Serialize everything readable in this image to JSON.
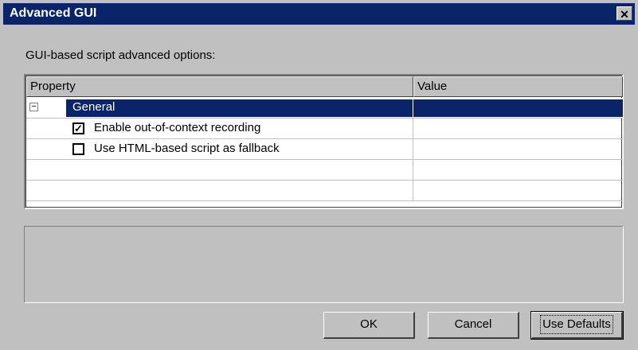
{
  "window": {
    "title": "Advanced GUI",
    "close_glyph": "✕"
  },
  "subtitle": "GUI-based script advanced options:",
  "grid": {
    "columns": [
      "Property",
      "Value"
    ],
    "group": {
      "expander": "−",
      "label": "General"
    },
    "options": [
      {
        "label": "Enable out-of-context recording",
        "checked": true,
        "check_glyph": "✓"
      },
      {
        "label": "Use HTML-based script as fallback",
        "checked": false,
        "check_glyph": ""
      }
    ]
  },
  "buttons": {
    "ok": "OK",
    "cancel": "Cancel",
    "defaults": "Use Defaults"
  },
  "colors": {
    "titlebar": "#0a246a",
    "face": "#c0c0c0",
    "selection": "#0a246a"
  }
}
